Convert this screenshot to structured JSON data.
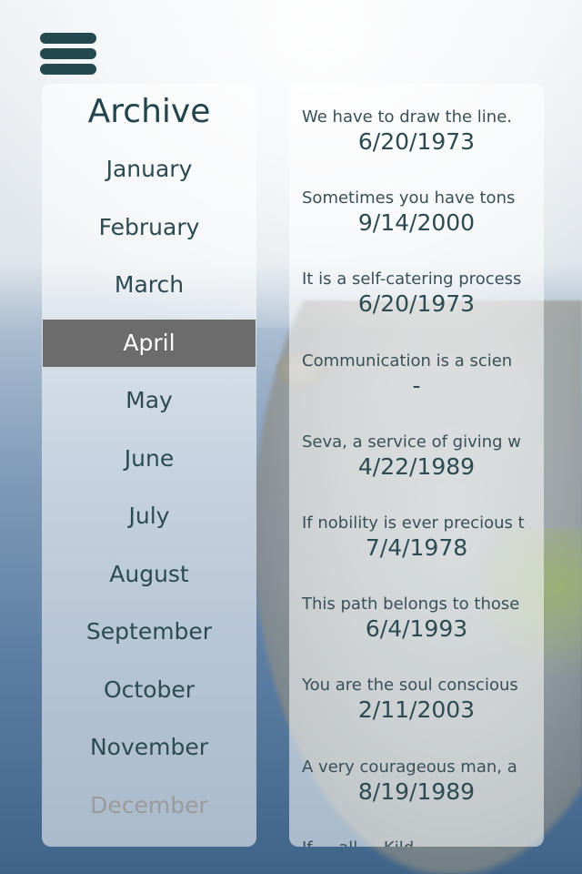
{
  "menu": {
    "icon": "hamburger-menu-icon"
  },
  "archive": {
    "title": "Archive",
    "months": [
      "January",
      "February",
      "March",
      "April",
      "May",
      "June",
      "July",
      "August",
      "September",
      "October",
      "November",
      "December"
    ],
    "selected_month": "April",
    "faded_month": "December"
  },
  "entries": [
    {
      "snippet": "We have to draw the line.",
      "date": "6/20/1973"
    },
    {
      "snippet": "Sometimes you have tons",
      "date": "9/14/2000"
    },
    {
      "snippet": "It is a self-catering process",
      "date": "6/20/1973"
    },
    {
      "snippet": "Communication is a scien",
      "date": "-"
    },
    {
      "snippet": "Seva, a service of giving w",
      "date": "4/22/1989"
    },
    {
      "snippet": "If nobility is ever precious t",
      "date": "7/4/1978"
    },
    {
      "snippet": "This path belongs to those",
      "date": "6/4/1993"
    },
    {
      "snippet": "You are the soul conscious",
      "date": "2/11/2003"
    },
    {
      "snippet": "A very courageous man, a",
      "date": "8/19/1989"
    },
    {
      "snippet": "If ... all ... Kild",
      "date": ""
    }
  ],
  "colors": {
    "menu_bar": "#25474f",
    "selected_bg": "#6c6c6c",
    "text": "#2c4a52"
  }
}
